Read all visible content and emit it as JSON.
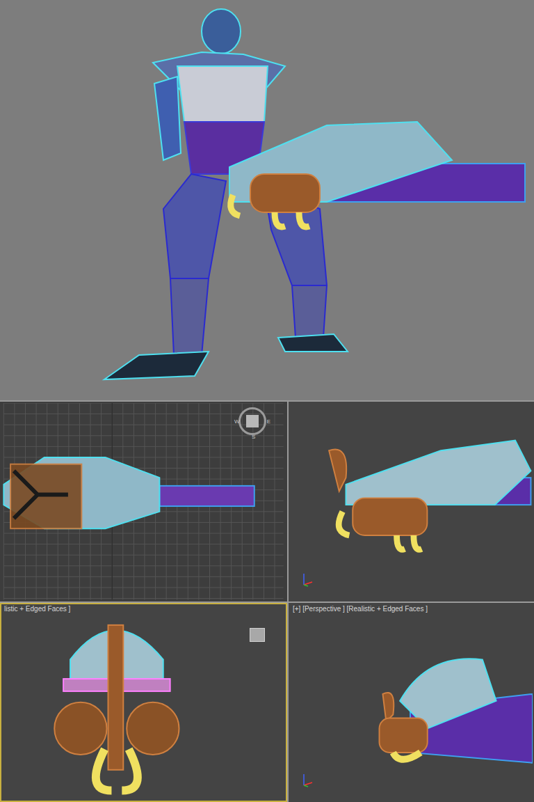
{
  "render": {
    "subject": "armored soldier with minigun"
  },
  "viewports": [
    {
      "kind": "top",
      "label": "",
      "active": false,
      "compass": [
        "W",
        "E",
        "S"
      ]
    },
    {
      "kind": "side",
      "label": "",
      "active": false,
      "compass": []
    },
    {
      "kind": "front",
      "label": "listic + Edged Faces ]",
      "active": true,
      "compass": []
    },
    {
      "kind": "perspective",
      "label": "[+] [Perspective ] [Realistic + Edged Faces ]",
      "active": false,
      "compass": []
    }
  ]
}
